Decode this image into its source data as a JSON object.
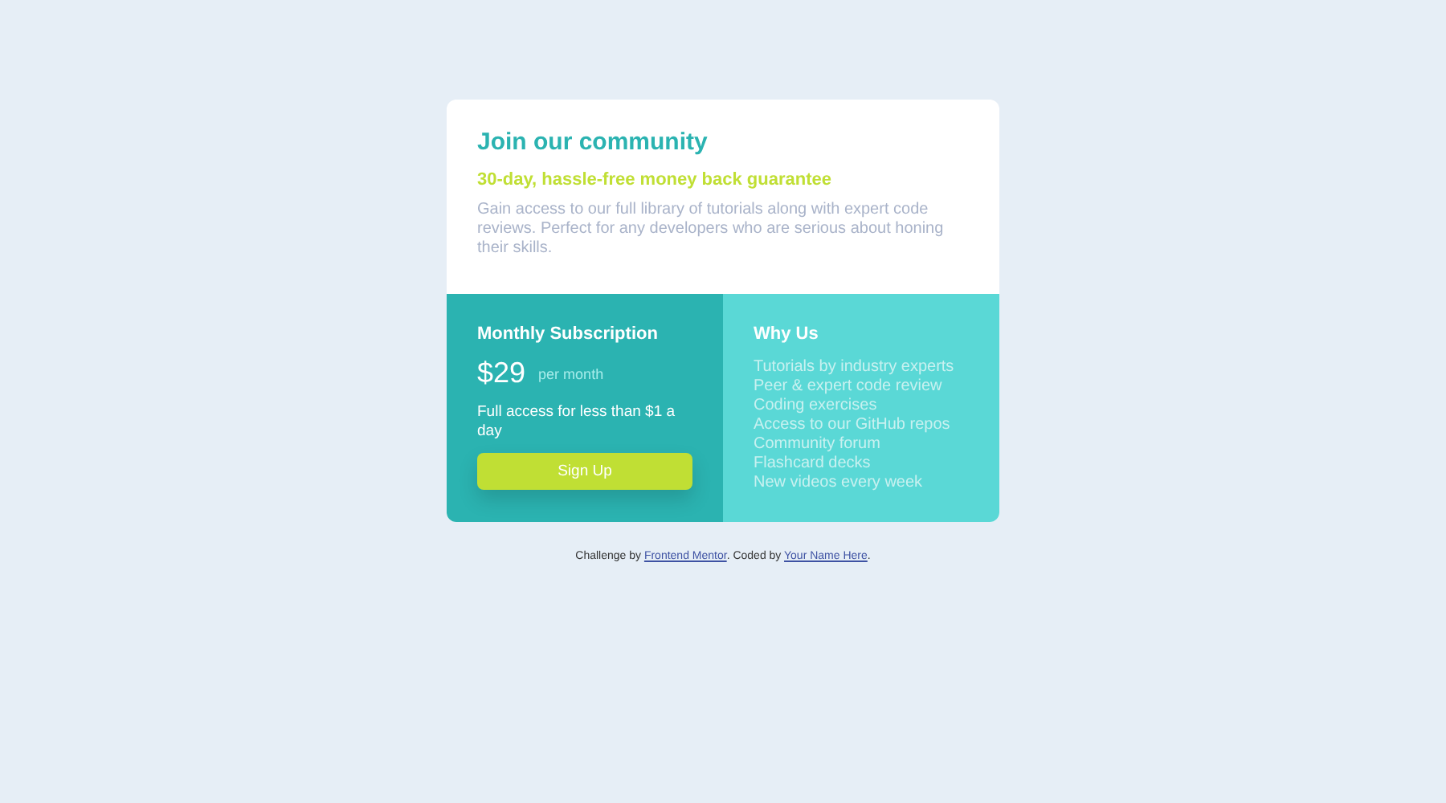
{
  "card": {
    "title": "Join our community",
    "subtitle": "30-day, hassle-free money back guarantee",
    "description": "Gain access to our full library of tutorials along with expert code reviews. Perfect for any developers who are serious about honing their skills.",
    "subscription": {
      "heading": "Monthly Subscription",
      "price": "$29",
      "period": "per month",
      "note": "Full access for less than $1 a day",
      "button": "Sign Up"
    },
    "why_us": {
      "heading": "Why Us",
      "items": [
        "Tutorials by industry experts",
        "Peer & expert code review",
        "Coding exercises",
        "Access to our GitHub repos",
        "Community forum",
        "Flashcard decks",
        "New videos every week"
      ]
    }
  },
  "attribution": [
    {
      "kind": "text",
      "text": "Challenge by "
    },
    {
      "kind": "link",
      "text": "Frontend Mentor"
    },
    {
      "kind": "text",
      "text": ". Coded by "
    },
    {
      "kind": "link",
      "text": "Your Name Here"
    },
    {
      "kind": "text",
      "text": "."
    }
  ]
}
